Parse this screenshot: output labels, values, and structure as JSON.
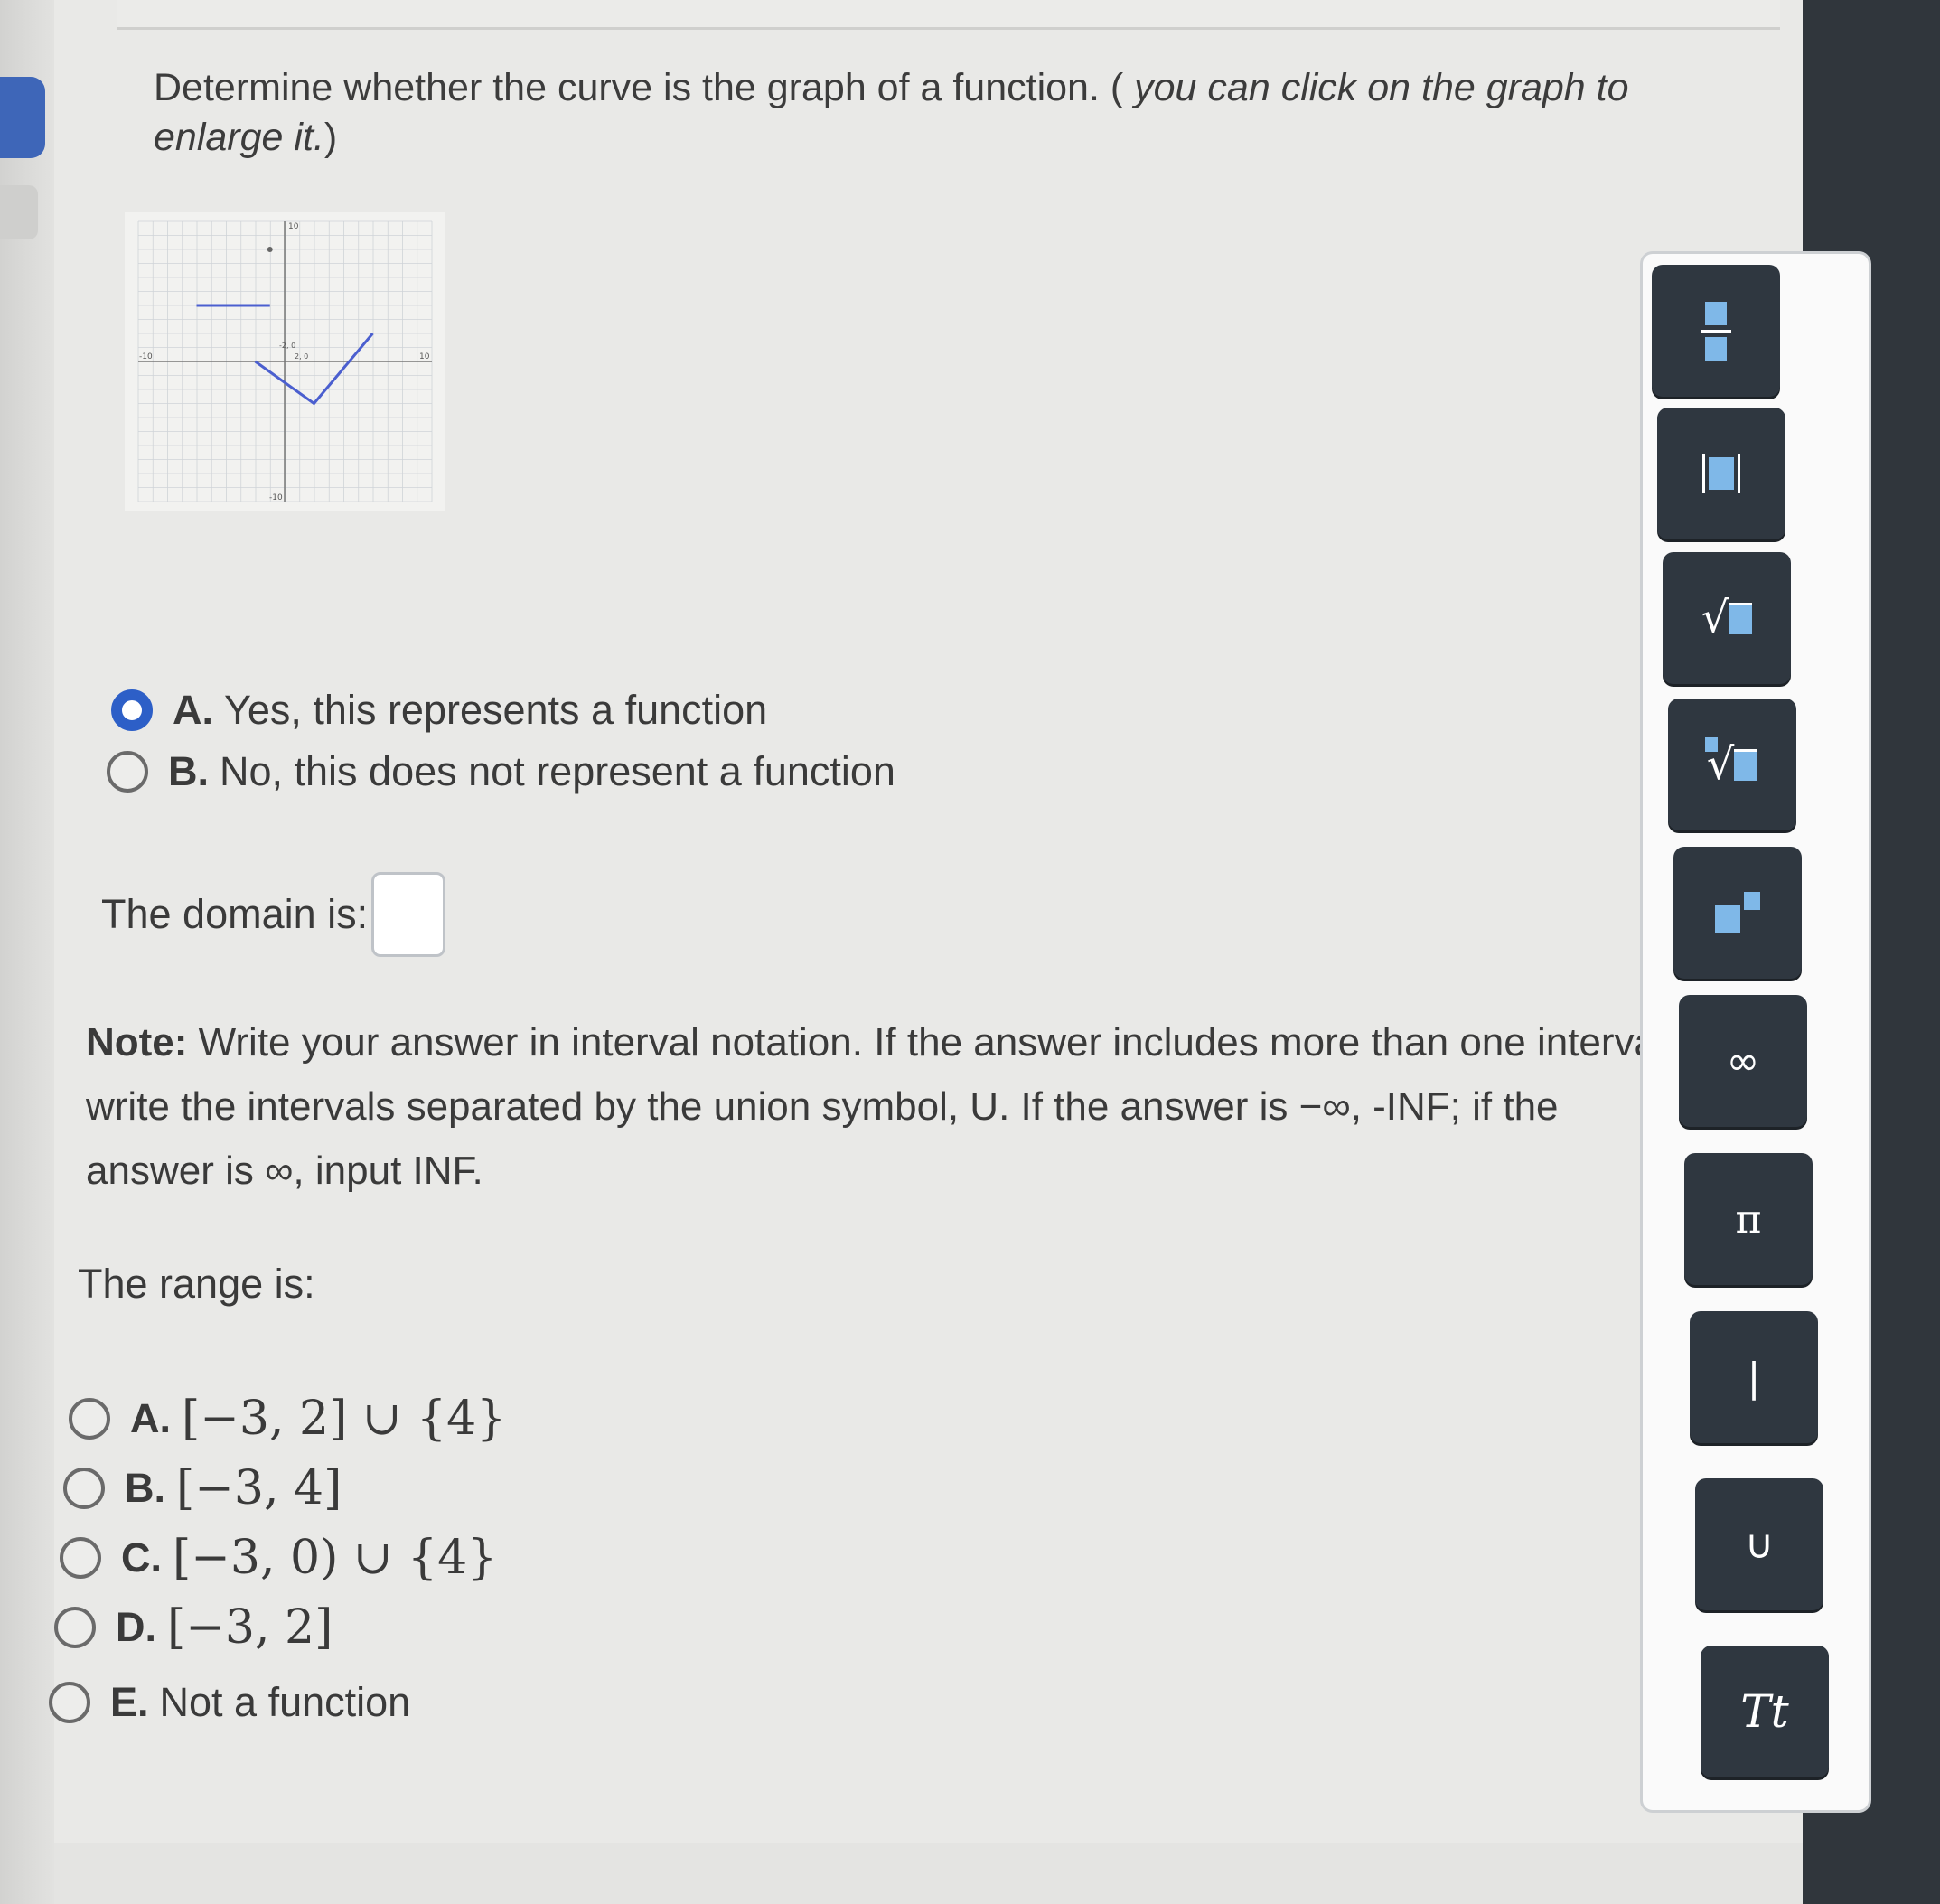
{
  "question": {
    "prompt": "Determine whether the curve is the graph of a function. (",
    "hint": "you can click on the graph to enlarge it.",
    "close": ")"
  },
  "graph": {
    "x_min_label": "-10",
    "x_max_label": "10",
    "y_max_label": "10",
    "y_min_label": "-10",
    "segment_points": [
      [
        -2,
        0
      ],
      [
        2,
        -3
      ],
      [
        6,
        2
      ]
    ],
    "horizontal_segment": [
      [
        -6,
        4
      ],
      [
        -1,
        4
      ]
    ],
    "marker_point": [
      -1,
      8
    ],
    "point_label_a": "-2, 0",
    "point_label_b": "2, 0"
  },
  "function_options": {
    "a_letter": "A.",
    "a_text": "Yes, this represents a function",
    "b_letter": "B.",
    "b_text": "No, this does not represent a function",
    "selected": "A"
  },
  "domain": {
    "label": "The domain is:",
    "value": ""
  },
  "note": {
    "bold": "Note:",
    "text": "Write your answer in interval notation. If the answer includes more than one interval write the intervals separated by the union symbol, U. If the answer is −∞, -INF; if the answer is ∞, input INF."
  },
  "range": {
    "label": "The range is:",
    "options": [
      {
        "letter": "A.",
        "text": "[−3, 2] ∪ {4}"
      },
      {
        "letter": "B.",
        "text": "[−3, 4]"
      },
      {
        "letter": "C.",
        "text": "[−3, 0) ∪ {4}"
      },
      {
        "letter": "D.",
        "text": "[−3, 2]"
      },
      {
        "letter": "E.",
        "text": "Not a function"
      }
    ]
  },
  "toolbar": {
    "infinity": "∞",
    "pi": "π",
    "bar": "|",
    "union": "∪",
    "text_style": "Tt"
  },
  "colors": {
    "accent": "#2d5fc7",
    "curve": "#4b5fcf",
    "toolbar_button": "#2f3740",
    "placeholder_square": "#7fb8e8"
  }
}
